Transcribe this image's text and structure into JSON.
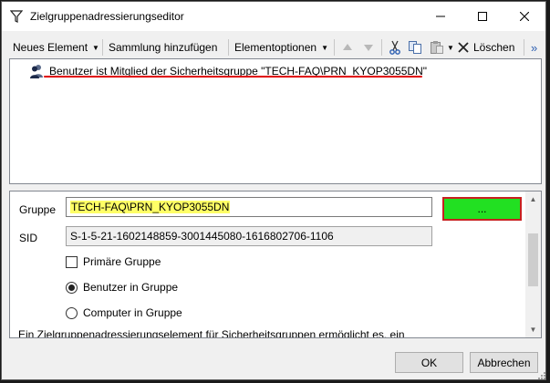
{
  "window": {
    "title": "Zielgruppenadressierungseditor"
  },
  "toolbar": {
    "new_element": "Neues Element",
    "add_collection": "Sammlung hinzufügen",
    "element_options": "Elementoptionen",
    "delete": "Löschen",
    "overflow": "»"
  },
  "tree": {
    "items": [
      {
        "label": "Benutzer ist Mitglied der Sicherheitsgruppe \"TECH-FAQ\\PRN_KYOP3055DN\""
      }
    ]
  },
  "properties": {
    "group_label": "Gruppe",
    "group_value": "TECH-FAQ\\PRN_KYOP3055DN",
    "browse_label": "...",
    "sid_label": "SID",
    "sid_value": "S-1-5-21-1602148859-3001445080-1616802706-1106",
    "primary_group_label": "Primäre Gruppe",
    "users_in_group_label": "Benutzer in Gruppe",
    "computers_in_group_label": "Computer in Gruppe",
    "description": "Ein Zielgruppenadressierungselement für Sicherheitsgruppen ermöglicht es, ein"
  },
  "footer": {
    "ok": "OK",
    "cancel": "Abbrechen"
  },
  "colors": {
    "highlight": "#ffff66",
    "browse_button": "#22e022",
    "annotation": "#e00000"
  }
}
